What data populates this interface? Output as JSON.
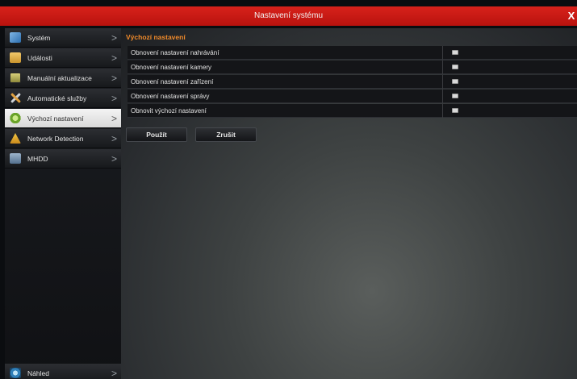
{
  "window": {
    "title": "Nastavení systému",
    "close_glyph": "X"
  },
  "sidebar": {
    "items": [
      {
        "label": "Systém",
        "icon": "system-icon"
      },
      {
        "label": "Události",
        "icon": "events-icon"
      },
      {
        "label": "Manuální aktualizace",
        "icon": "manual-update-icon"
      },
      {
        "label": "Automatické služby",
        "icon": "tools-icon"
      },
      {
        "label": "Výchozí nastavení",
        "icon": "default-settings-icon",
        "active": true
      },
      {
        "label": "Network Detection",
        "icon": "network-warning-icon"
      },
      {
        "label": "MHDD",
        "icon": "hdd-icon"
      }
    ],
    "bottom_item": {
      "label": "Náhled",
      "icon": "preview-icon"
    },
    "chevron": ">"
  },
  "main": {
    "section_title": "Výchozí nastavení",
    "options": [
      {
        "label": "Obnovení nastavení nahrávání",
        "checked": false
      },
      {
        "label": "Obnovení nastavení kamery",
        "checked": false
      },
      {
        "label": "Obnovení nastavení zařízení",
        "checked": false
      },
      {
        "label": "Obnovení nastavení správy",
        "checked": false
      },
      {
        "label": "Obnovit výchozí nastavení",
        "checked": false
      }
    ],
    "apply_label": "Použít",
    "cancel_label": "Zrušit"
  },
  "colors": {
    "title_bar": "#c8170f",
    "section_title": "#f08a2a",
    "active_item": "#e6e6e6"
  }
}
